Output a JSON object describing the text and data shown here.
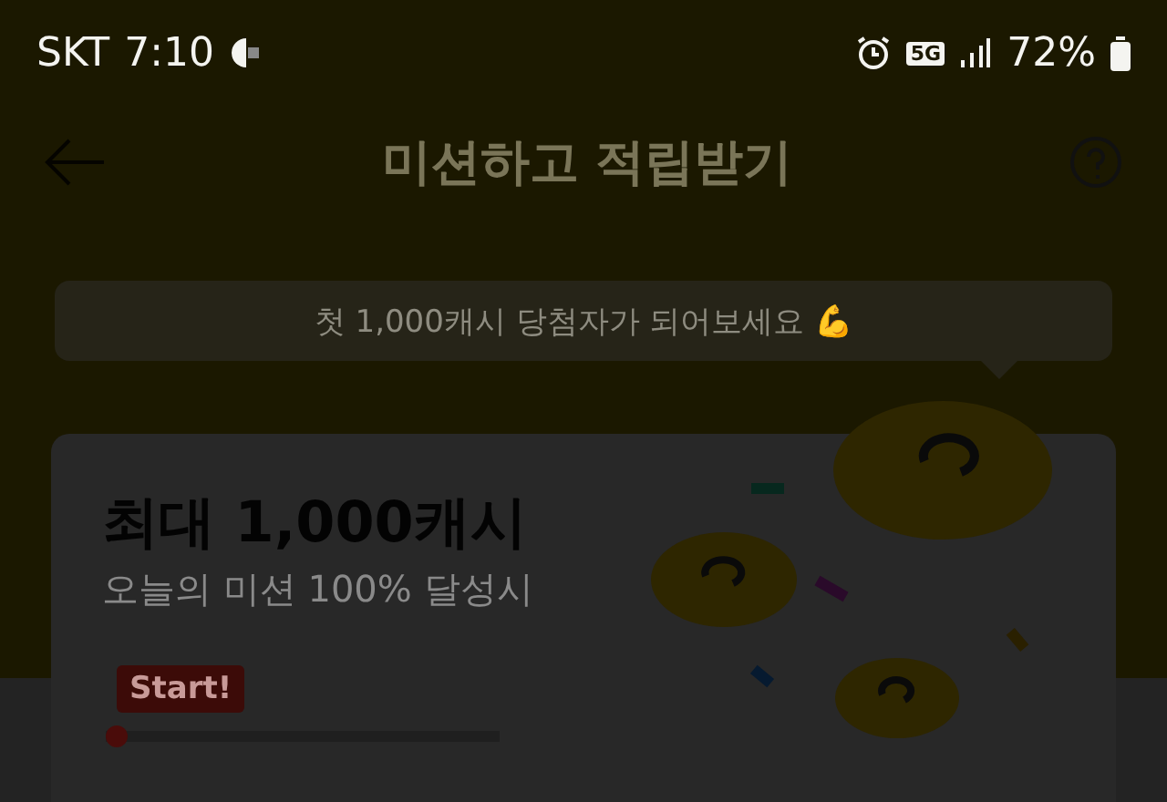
{
  "status_bar": {
    "carrier": "SKT",
    "time": "7:10",
    "network": "5G",
    "battery": "72%"
  },
  "header": {
    "title": "미션하고 적립받기"
  },
  "bubble": {
    "text": "첫 1,000캐시 당첨자가 되어보세요 💪"
  },
  "card": {
    "title": "최대 1,000캐시",
    "subtitle": "오늘의 미션 100% 달성시",
    "badge": "Start!",
    "progress": {
      "level": 0
    }
  }
}
